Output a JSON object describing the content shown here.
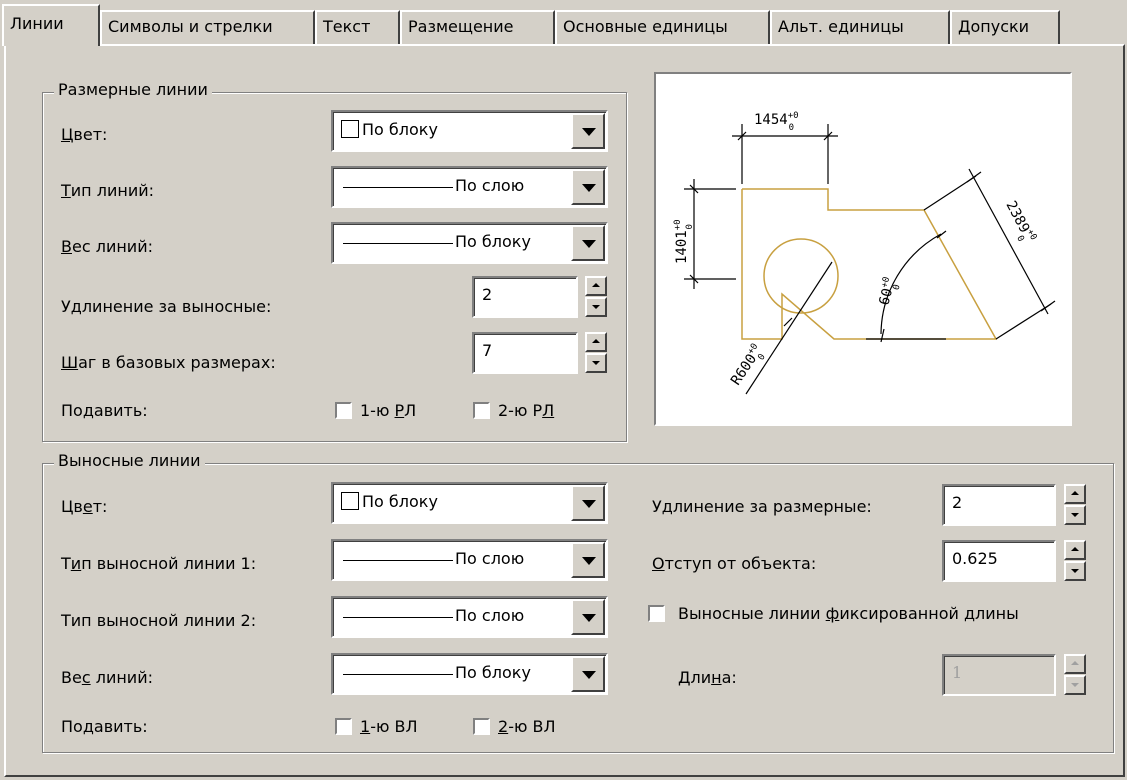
{
  "tabs": [
    "Линии",
    "Символы и стрелки",
    "Текст",
    "Размещение",
    "Основные единицы",
    "Альт. единицы",
    "Допуски"
  ],
  "dimension_lines": {
    "title": "Размерные линии",
    "color": {
      "label_pre": "",
      "label_u": "Ц",
      "label_post": "вет:",
      "value": "По блоку"
    },
    "linetype": {
      "label_pre": "",
      "label_u": "Т",
      "label_post": "ип линий:",
      "value": "По слою"
    },
    "lineweight": {
      "label_pre": "",
      "label_u": "В",
      "label_post": "ес линий:",
      "value": "По блоку"
    },
    "extend_beyond": {
      "label": "Удлинение за выносные:",
      "value": "2"
    },
    "baseline_spacing": {
      "label_pre": "",
      "label_u": "Ш",
      "label_post": "аг в базовых размерах:",
      "value": "7"
    },
    "suppress": {
      "label": "Подавить:",
      "opt1_pre": "1-ю ",
      "opt1_u": "Р",
      "opt1_post": "Л",
      "opt2_pre": "2-ю Р",
      "opt2_u": "Л",
      "opt2_post": ""
    }
  },
  "extension_lines": {
    "title": "Выносные линии",
    "color": {
      "label_pre": "Цв",
      "label_u": "е",
      "label_post": "т:",
      "value": "По блоку"
    },
    "linetype1": {
      "label_pre": "Т",
      "label_u": "и",
      "label_post": "п выносной линии 1:",
      "value": "По слою"
    },
    "linetype2": {
      "label": "Тип выносной линии 2:",
      "value": "По слою"
    },
    "lineweight": {
      "label_pre": "Ве",
      "label_u": "с",
      "label_post": " линий:",
      "value": "По блоку"
    },
    "suppress": {
      "label": "Подавить:",
      "opt1_pre": "",
      "opt1_u": "1",
      "opt1_post": "-ю ВЛ",
      "opt2_pre": "",
      "opt2_u": "2",
      "opt2_post": "-ю ВЛ"
    },
    "extend_beyond_dim": {
      "label": "Удлинение за размерные:",
      "value": "2"
    },
    "offset": {
      "label_pre": "",
      "label_u": "О",
      "label_post": "тступ от объекта:",
      "value": "0.625"
    },
    "fixed_length": {
      "label_pre": "Выносные линии ",
      "label_u": "ф",
      "label_post": "иксированной длины"
    },
    "length": {
      "label_pre": "Дли",
      "label_u": "н",
      "label_post": "а:",
      "value": "1"
    }
  },
  "preview": {
    "dim_top": "1454",
    "dim_left": "1401",
    "dim_right": "2389",
    "dim_angle": "60",
    "dim_radius": "R600",
    "sup": "+0",
    "sub": "0",
    "geometry_color": "#c8a040"
  }
}
